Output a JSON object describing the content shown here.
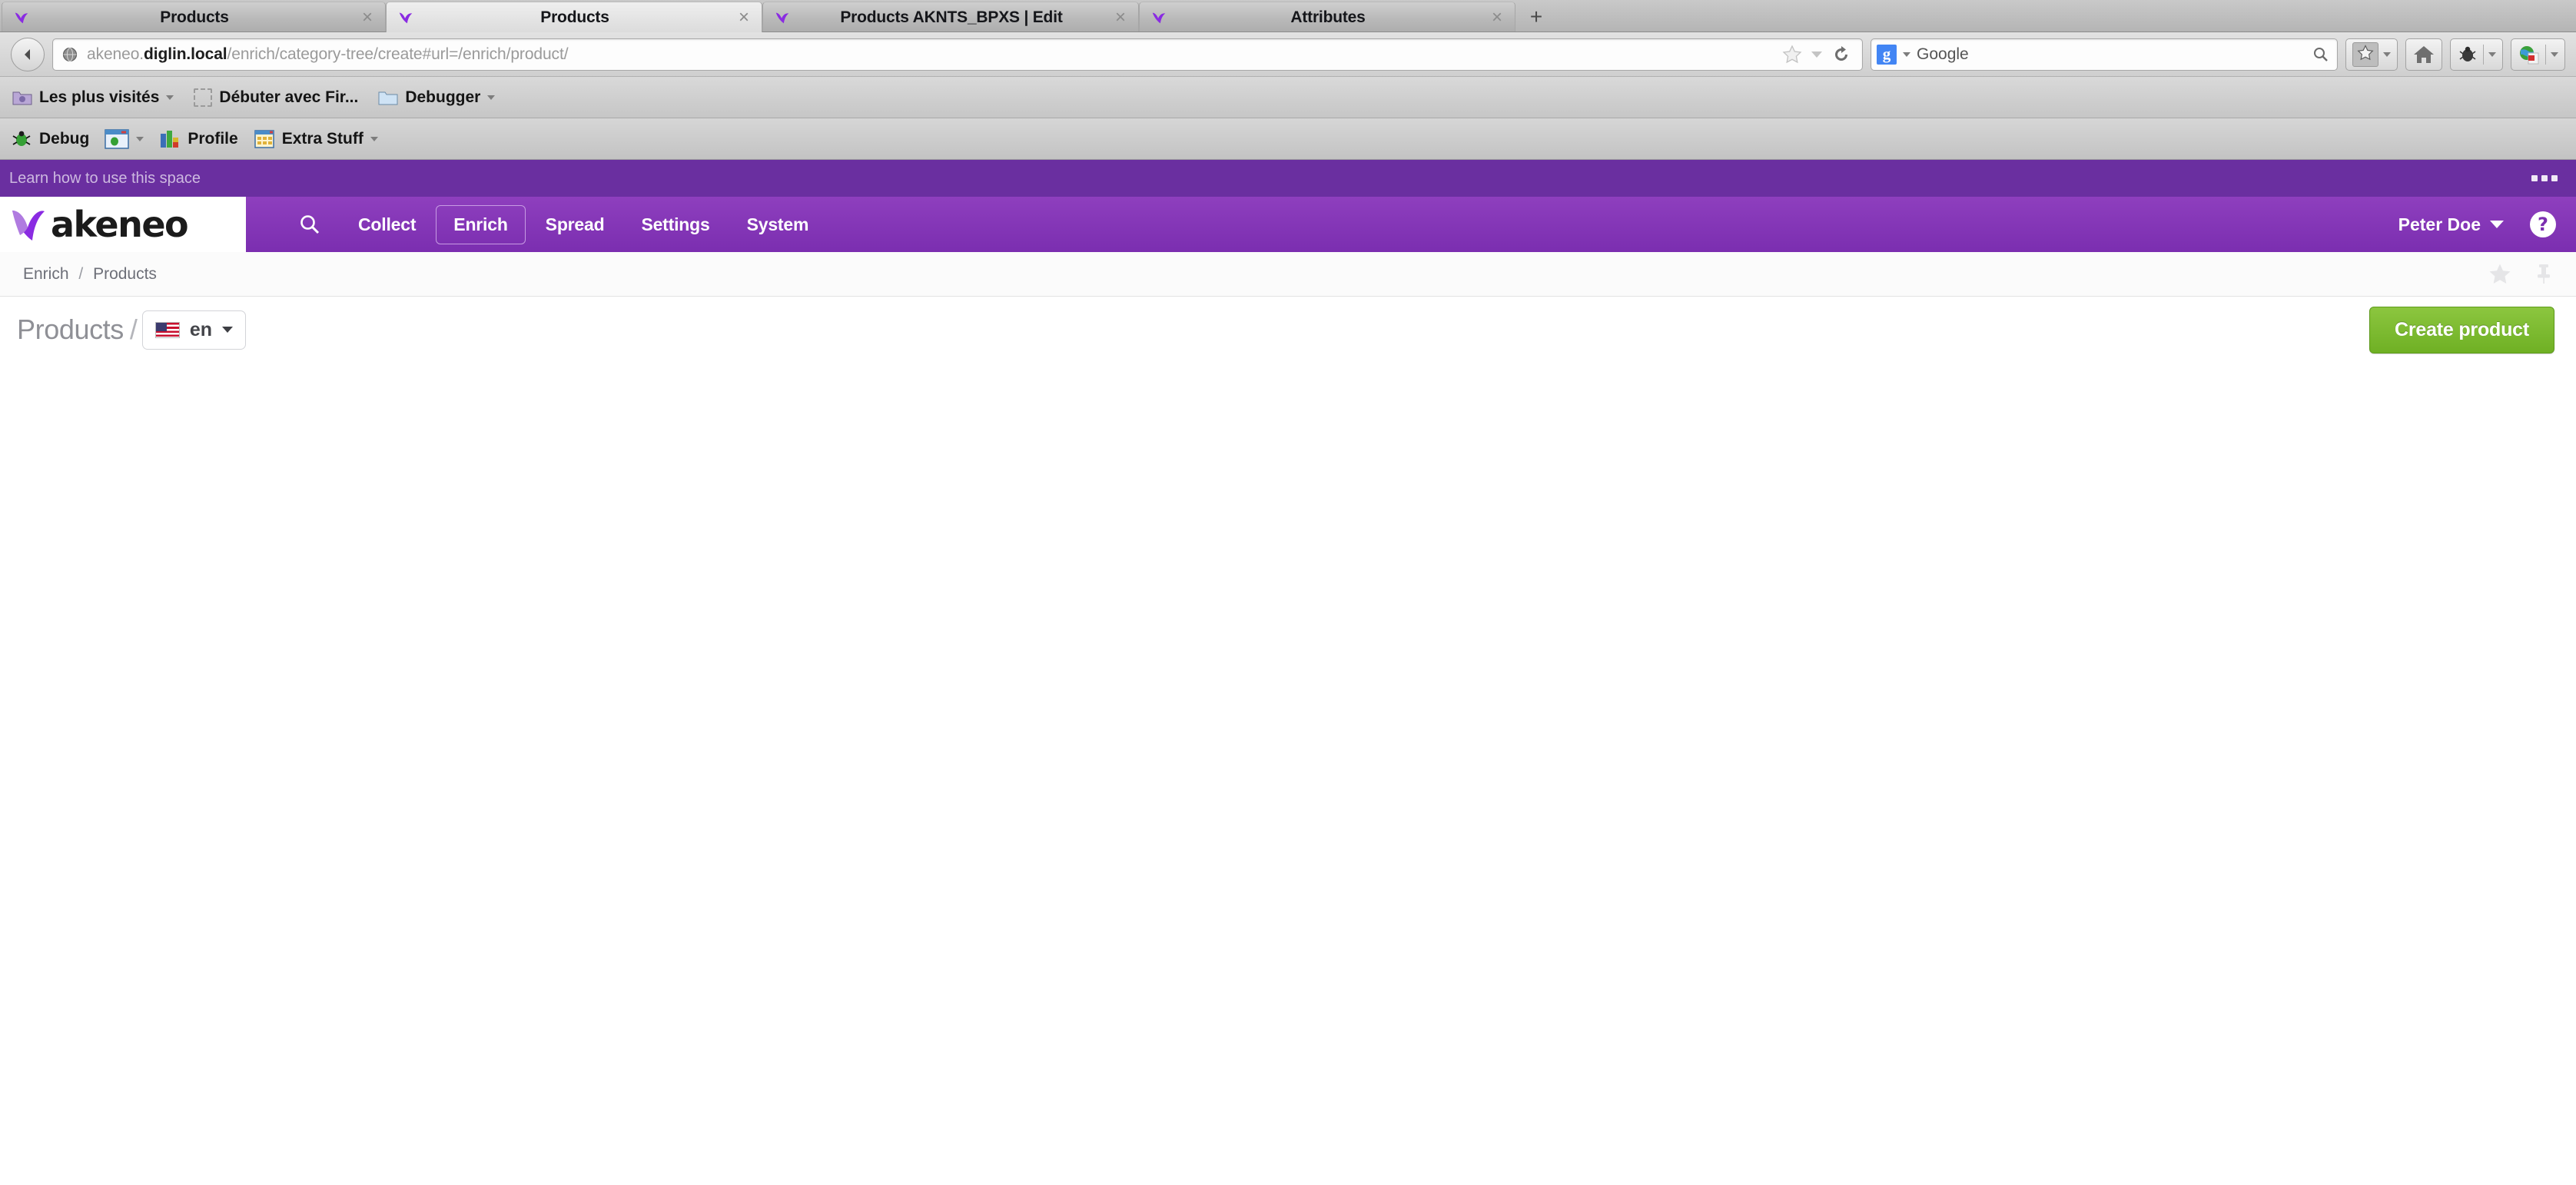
{
  "browser": {
    "tabs": [
      {
        "title": "Products",
        "favicon": "akeneo-favicon",
        "active": false,
        "close": "×"
      },
      {
        "title": "Products",
        "favicon": "akeneo-favicon",
        "active": true,
        "close": "×"
      },
      {
        "title": "Products AKNTS_BPXS | Edit",
        "favicon": "akeneo-favicon",
        "active": false,
        "close": "×"
      },
      {
        "title": "Attributes",
        "favicon": "akeneo-favicon",
        "active": false,
        "close": "×"
      }
    ],
    "new_tab_label": "+",
    "back_icon": "back-arrow-icon",
    "url": {
      "icon": "globe-icon",
      "prefix": "akeneo.",
      "host": "diglin.local",
      "path": "/enrich/category-tree/create#url=/enrich/product/",
      "full": "akeneo.diglin.local/enrich/category-tree/create#url=/enrich/product/",
      "bookmark_star_icon": "star-outline-icon",
      "dropdown_icon": "chevron-down-icon",
      "reload_icon": "reload-icon"
    },
    "search": {
      "engine": "Google",
      "engine_badge": "g",
      "engine_dropdown_icon": "chevron-down-icon",
      "search_icon": "search-icon"
    },
    "toolbar_buttons": [
      {
        "name": "bookmarks-sidebar-button",
        "icon": "star-filled-icon",
        "has_dropdown": true
      },
      {
        "name": "home-button",
        "icon": "home-icon",
        "has_dropdown": false
      },
      {
        "name": "firebug-button",
        "icon": "firebug-icon",
        "has_dropdown": true
      },
      {
        "name": "pdf-download-button",
        "icon": "globe-pdf-icon",
        "has_dropdown": true
      }
    ],
    "bookmarks": [
      {
        "label": "Les plus visités",
        "icon": "most-visited-folder-icon",
        "has_dropdown": true
      },
      {
        "label": "Débuter avec Fir...",
        "icon": "dotted-placeholder-icon",
        "has_dropdown": false
      },
      {
        "label": "Debugger",
        "icon": "folder-icon",
        "has_dropdown": true
      }
    ],
    "devbar": [
      {
        "label": "Debug",
        "icon": "bug-icon",
        "has_dropdown": false
      },
      {
        "label": "",
        "icon": "window-bug-icon",
        "has_dropdown": true
      },
      {
        "label": "Profile",
        "icon": "chart-icon",
        "has_dropdown": false
      },
      {
        "label": "Extra Stuff",
        "icon": "grid-icon",
        "has_dropdown": true
      }
    ]
  },
  "app": {
    "banner": {
      "link_text": "Learn how to use this space",
      "menu_icon": "ellipsis-icon"
    },
    "brand": {
      "logo_text": "akeneo",
      "logo_mark": "akeneo-leaf-icon"
    },
    "nav": {
      "search_icon": "search-icon",
      "items": [
        {
          "label": "Collect",
          "active": false
        },
        {
          "label": "Enrich",
          "active": true
        },
        {
          "label": "Spread",
          "active": false
        },
        {
          "label": "Settings",
          "active": false
        },
        {
          "label": "System",
          "active": false
        }
      ],
      "user": {
        "name": "Peter Doe",
        "caret_icon": "chevron-down-icon"
      },
      "help_icon": "help-circle-icon",
      "help_glyph": "?"
    },
    "breadcrumb": {
      "parent": "Enrich",
      "separator": "/",
      "current": "Products",
      "favorite_icon": "star-icon",
      "pin_icon": "pin-icon"
    },
    "title_bar": {
      "title": "Products",
      "separator": "/",
      "locale": {
        "code": "en",
        "flag": "us-flag-icon",
        "caret_icon": "chevron-down-icon"
      },
      "primary_action": "Create product"
    },
    "colors": {
      "brand_purple": "#7b2eb0",
      "banner_purple": "#6a2fa0",
      "accent_green": "#76b52a",
      "text_gray": "#8f9096"
    }
  }
}
